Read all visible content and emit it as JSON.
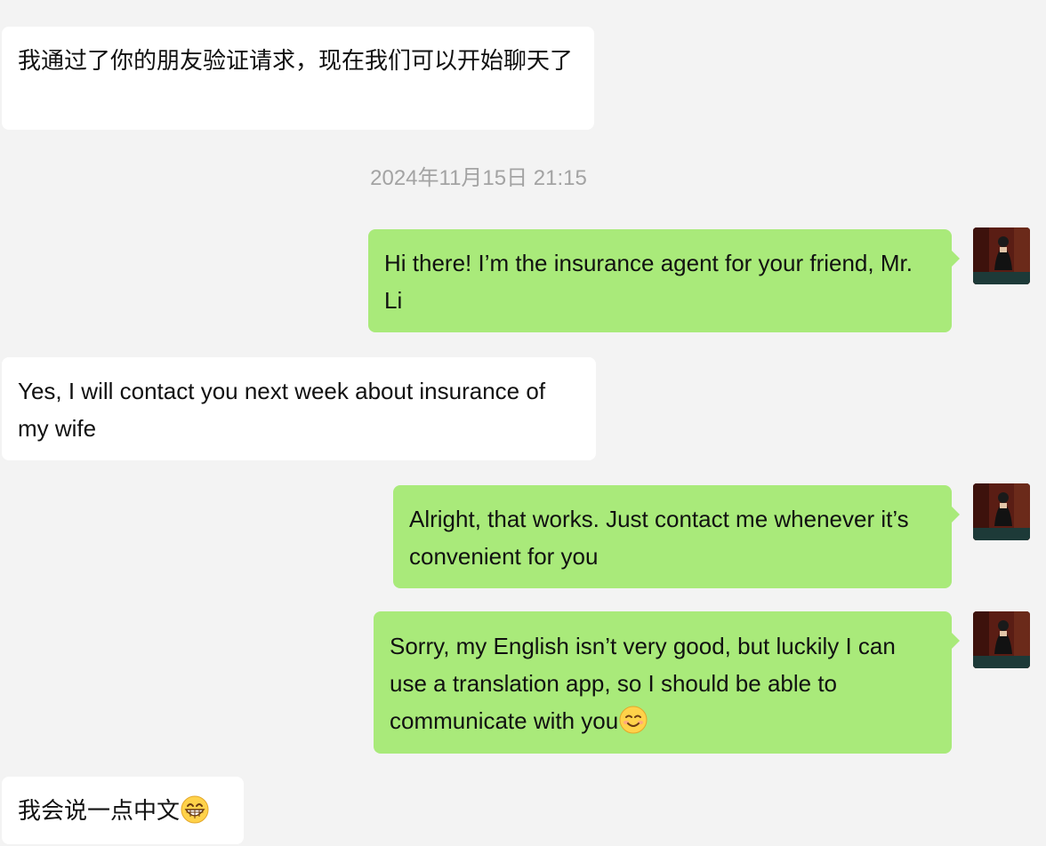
{
  "chat": {
    "timestamp": "2024年11月15日 21:15",
    "messages": [
      {
        "sender": "contact",
        "text": "我通过了你的朋友验证请求，现在我们可以开始聊天了"
      },
      {
        "sender": "me",
        "text": "Hi there! I’m the insurance agent for your friend, Mr. Li"
      },
      {
        "sender": "contact",
        "text": "Yes, I will contact you next week about insurance of my wife"
      },
      {
        "sender": "me",
        "text": "Alright, that works. Just contact me whenever it’s convenient for you"
      },
      {
        "sender": "me",
        "text": "Sorry, my English isn’t very good, but luckily I can use a translation app, so I should be able to communicate with you",
        "emoji": "smiling-face-emoji"
      },
      {
        "sender": "contact",
        "text": "我会说一点中文",
        "emoji": "grinning-face-emoji"
      }
    ]
  },
  "colors": {
    "background": "#f3f3f3",
    "incoming_bubble": "#ffffff",
    "outgoing_bubble": "#a9ea7a",
    "timestamp_text": "#a3a3a3"
  }
}
